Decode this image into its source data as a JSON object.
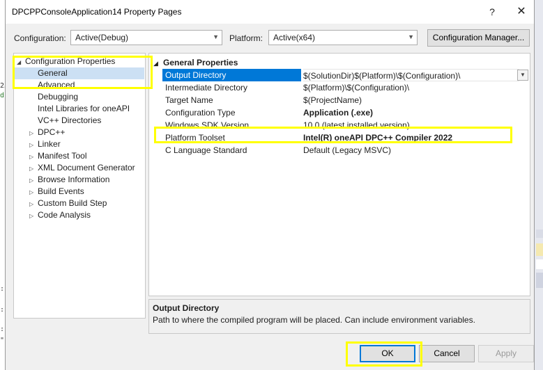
{
  "window": {
    "title": "DPCPPConsoleApplication14 Property Pages",
    "help_glyph": "?",
    "close_glyph": "✕"
  },
  "toolbar": {
    "configuration_label": "Configuration:",
    "configuration_value": "Active(Debug)",
    "platform_label": "Platform:",
    "platform_value": "Active(x64)",
    "configuration_manager_label": "Configuration Manager..."
  },
  "tree": {
    "items": [
      {
        "label": "Configuration Properties",
        "expander": "◢"
      },
      {
        "label": "General"
      },
      {
        "label": "Advanced"
      },
      {
        "label": "Debugging"
      },
      {
        "label": "Intel Libraries for oneAPI"
      },
      {
        "label": "VC++ Directories"
      },
      {
        "label": "DPC++",
        "expander": "▷"
      },
      {
        "label": "Linker",
        "expander": "▷"
      },
      {
        "label": "Manifest Tool",
        "expander": "▷"
      },
      {
        "label": "XML Document Generator",
        "expander": "▷"
      },
      {
        "label": "Browse Information",
        "expander": "▷"
      },
      {
        "label": "Build Events",
        "expander": "▷"
      },
      {
        "label": "Custom Build Step",
        "expander": "▷"
      },
      {
        "label": "Code Analysis",
        "expander": "▷"
      }
    ]
  },
  "grid": {
    "section_title": "General Properties",
    "section_chevron": "◢",
    "rows": [
      {
        "name": "Output Directory",
        "value": "$(SolutionDir)$(Platform)\\$(Configuration)\\"
      },
      {
        "name": "Intermediate Directory",
        "value": "$(Platform)\\$(Configuration)\\"
      },
      {
        "name": "Target Name",
        "value": "$(ProjectName)"
      },
      {
        "name": "Configuration Type",
        "value": "Application (.exe)"
      },
      {
        "name": "Windows SDK Version",
        "value": "10.0 (latest installed version)"
      },
      {
        "name": "Platform Toolset",
        "value": "Intel(R) oneAPI DPC++ Compiler 2022"
      },
      {
        "name": "C Language Standard",
        "value": "Default (Legacy MSVC)"
      }
    ]
  },
  "description": {
    "title": "Output Directory",
    "text": "Path to where the compiled program will be placed. Can include environment variables."
  },
  "buttons": {
    "ok": "OK",
    "cancel": "Cancel",
    "apply": "Apply"
  },
  "colors": {
    "selection_blue": "#0078d7",
    "tree_selection": "#cce0f4",
    "highlight_yellow": "#ffff00"
  },
  "icons": [
    "help-icon",
    "close-icon",
    "chevron-down-icon",
    "expand-arrow-icon",
    "collapse-arrow-icon"
  ]
}
